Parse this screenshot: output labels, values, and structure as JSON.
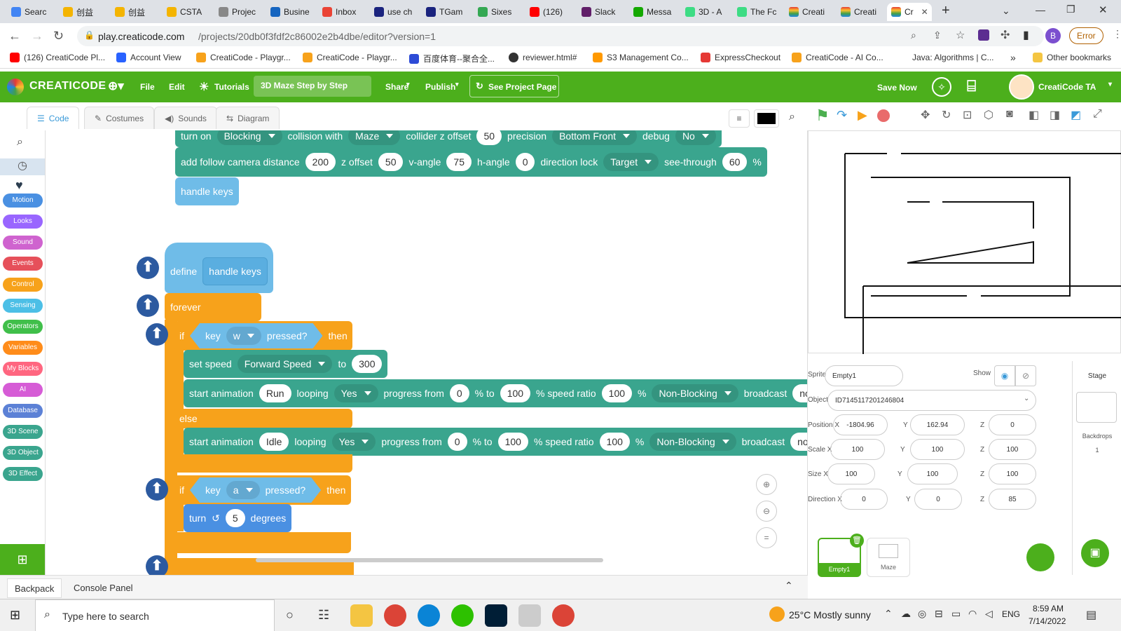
{
  "browser": {
    "tabs": [
      "Searc",
      "创益",
      "创益",
      "CSTA",
      "Projec",
      "Busine",
      "Inbox",
      "use ch",
      "TGam",
      "Sixes",
      "(126)",
      "Slack",
      "Messa",
      "3D - A",
      "The Fc",
      "Creati",
      "Creati",
      "Cr"
    ],
    "url_host": "play.creaticode.com",
    "url_path": "/projects/20db0f3fdf2c86002e2b4dbe/editor?version=1",
    "error_label": "Error",
    "profile_letter": "B",
    "bookmarks": [
      "(126) CreatiCode Pl...",
      "Account View",
      "CreatiCode - Playgr...",
      "CreatiCode - Playgr...",
      "百度体育--聚合全...",
      "reviewer.html#",
      "S3 Management Co...",
      "ExpressCheckout",
      "CreatiCode - AI Co...",
      "Java: Algorithms | C...",
      "Other bookmarks"
    ]
  },
  "app": {
    "logo": "CREATICODE",
    "menu_file": "File",
    "menu_edit": "Edit",
    "menu_tutorials": "Tutorials",
    "project_title": "3D Maze Step by Step",
    "menu_share": "Share",
    "menu_publish": "Publish",
    "see_project": "See Project Page",
    "save_now": "Save Now",
    "user_name": "CreatiCode TA"
  },
  "editor_tabs": {
    "code": "Code",
    "costumes": "Costumes",
    "sounds": "Sounds",
    "diagram": "Diagram"
  },
  "categories": [
    {
      "label": "Motion",
      "color": "#4a90e2"
    },
    {
      "label": "Looks",
      "color": "#9966ff"
    },
    {
      "label": "Sound",
      "color": "#cf63cf"
    },
    {
      "label": "Events",
      "color": "#e6505a"
    },
    {
      "label": "Control",
      "color": "#f7a21b"
    },
    {
      "label": "Sensing",
      "color": "#4cbfe6"
    },
    {
      "label": "Operators",
      "color": "#40bf4a"
    },
    {
      "label": "Variables",
      "color": "#ff8c1a"
    },
    {
      "label": "My Blocks",
      "color": "#ff6680"
    },
    {
      "label": "AI",
      "color": "#d65cd6"
    },
    {
      "label": "Database",
      "color": "#5c81d6"
    },
    {
      "label": "3D Scene",
      "color": "#3aa58e"
    },
    {
      "label": "3D Object",
      "color": "#3aa58e"
    },
    {
      "label": "3D Effect",
      "color": "#3aa58e"
    }
  ],
  "blocks": {
    "b1": {
      "turn_on": "turn on",
      "mode": "Blocking",
      "collision_with": "collision with",
      "target": "Maze",
      "collider_z": "collider z offset",
      "z_val": "50",
      "precision": "precision",
      "prec_val": "Bottom Front",
      "debug": "debug",
      "debug_val": "No"
    },
    "b2": {
      "label": "add follow camera distance",
      "dist": "200",
      "zoff": "z offset",
      "zoff_val": "50",
      "vangle": "v-angle",
      "vangle_val": "75",
      "hangle": "h-angle",
      "hangle_val": "0",
      "dirlock": "direction lock",
      "dirlock_val": "Target",
      "seethrough": "see-through",
      "see_val": "60",
      "pct": "%"
    },
    "handle_keys": "handle keys",
    "define": "define",
    "forever": "forever",
    "if": "if",
    "then": "then",
    "else": "else",
    "key": "key",
    "pressed": "pressed?",
    "key_w": "w",
    "key_a": "a",
    "set_speed": "set speed",
    "speed_type": "Forward Speed",
    "to": "to",
    "speed_val": "300",
    "start_anim": "start animation",
    "anim_run": "Run",
    "anim_idle": "Idle",
    "looping": "looping",
    "yes": "Yes",
    "progress_from": "progress from",
    "zero": "0",
    "pct_to": "% to",
    "hundred": "100",
    "speed_ratio": "% speed ratio",
    "pct": "%",
    "non_blocking": "Non-Blocking",
    "broadcast": "broadcast",
    "broadcast_val": "non",
    "turn": "turn",
    "turn_val": "5",
    "degrees": "degrees"
  },
  "props": {
    "sprite_label": "Sprite",
    "sprite_val": "Empty1",
    "show_label": "Show",
    "object_label": "Object",
    "object_val": "ID7145117201246804",
    "posx_label": "Position X",
    "posx": "-1804.96",
    "y_label": "Y",
    "posy": "162.94",
    "z_label": "Z",
    "posz": "0",
    "scalex_label": "Scale X",
    "scalex": "100",
    "scaley": "100",
    "scalez": "100",
    "sizex_label": "Size X",
    "sizex": "100",
    "sizey": "100",
    "sizez": "100",
    "dirx_label": "Direction X",
    "dirx": "0",
    "diry": "0",
    "dirz": "85"
  },
  "sprites": [
    "Empty1",
    "Maze"
  ],
  "stage_panel": {
    "title": "Stage",
    "backdrops": "Backdrops",
    "count": "1"
  },
  "bottom": {
    "backpack": "Backpack",
    "console": "Console Panel"
  },
  "taskbar": {
    "search": "Type here to search",
    "weather": "25°C  Mostly sunny",
    "lang": "ENG",
    "time": "8:59 AM",
    "date": "7/14/2022"
  }
}
